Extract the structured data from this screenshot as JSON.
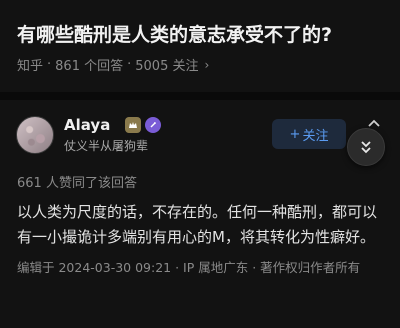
{
  "question": {
    "title": "有哪些酷刑是人类的意志承受不了的?",
    "meta": {
      "site": "知乎",
      "answers": "861 个回答",
      "followers": "5005 关注",
      "separator": "·"
    }
  },
  "author": {
    "name": "Alaya",
    "bio": "仗义半从屠狗辈",
    "follow_label": "关注",
    "follow_prefix": "+"
  },
  "answer": {
    "likes": "661 人赞同了该回答",
    "content": "以人类为尺度的话，不存在的。任何一种酷刑，都可以有一小撮诡计多端别有用心的M，将其转化为性癖好。",
    "edit_info": "编辑于 2024-03-30 09:21 · IP 属地广东 · 著作权归作者所有"
  },
  "colors": {
    "background": "#121212",
    "accent": "#5b9cf2",
    "muted_text": "#8a8a8a"
  },
  "icons": [
    "chevron-right-icon",
    "level-badge-icon",
    "verified-badge-icon",
    "more-icon",
    "collapse-icon"
  ]
}
